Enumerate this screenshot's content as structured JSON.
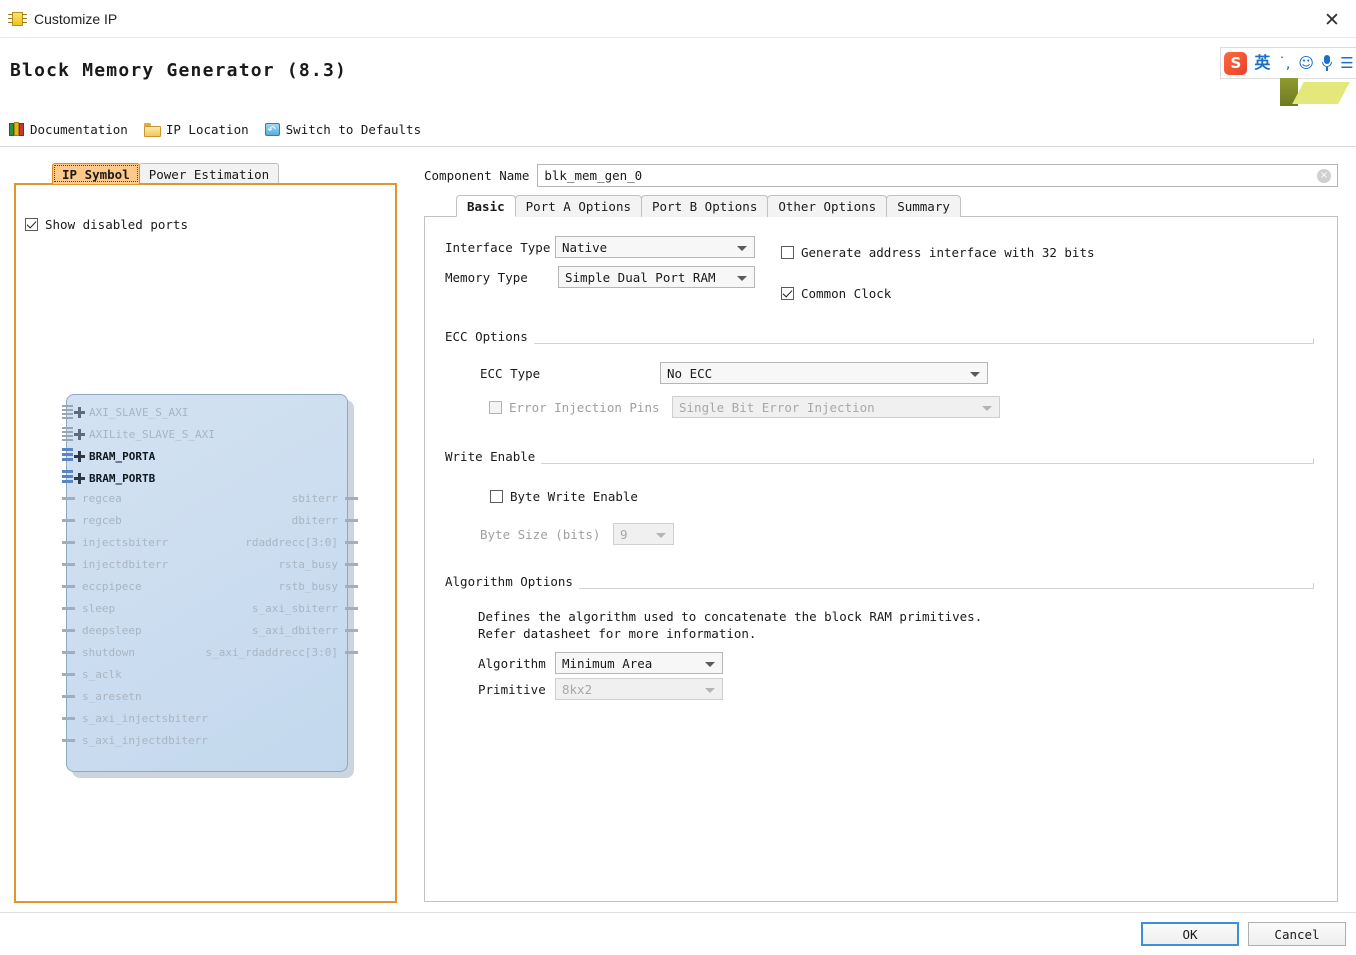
{
  "window": {
    "title": "Customize IP",
    "icon": "ip-chip-icon",
    "close_label": "✕"
  },
  "header": {
    "title": "Block Memory Generator  (8.3)"
  },
  "ime": {
    "logo": "S",
    "mode": "英",
    "punctuation": "˙,",
    "emoji": "☺",
    "mic": "microphone-icon",
    "extra": "☰"
  },
  "toolbar": {
    "items": [
      {
        "label": "Documentation",
        "icon": "books-icon"
      },
      {
        "label": "IP Location",
        "icon": "folder-icon"
      },
      {
        "label": "Switch to Defaults",
        "icon": "switch-icon"
      }
    ]
  },
  "left_panel": {
    "tabs": [
      {
        "label": "IP Symbol",
        "active": true
      },
      {
        "label": "Power Estimation",
        "active": false
      }
    ],
    "show_disabled_ports": {
      "label": "Show disabled ports",
      "checked": true
    },
    "bus_ports": [
      {
        "name": "AXI_SLAVE_S_AXI",
        "enabled": false
      },
      {
        "name": "AXILite_SLAVE_S_AXI",
        "enabled": false
      },
      {
        "name": "BRAM_PORTA",
        "enabled": true
      },
      {
        "name": "BRAM_PORTB",
        "enabled": true
      }
    ],
    "input_ports": [
      "regcea",
      "regceb",
      "injectsbiterr",
      "injectdbiterr",
      "eccpipece",
      "sleep",
      "deepsleep",
      "shutdown",
      "s_aclk",
      "s_aresetn",
      "s_axi_injectsbiterr",
      "s_axi_injectdbiterr"
    ],
    "output_ports": [
      "sbiterr",
      "dbiterr",
      "rdaddrecc[3:0]",
      "rsta_busy",
      "rstb_busy",
      "s_axi_sbiterr",
      "s_axi_dbiterr",
      "s_axi_rdaddrecc[3:0]"
    ]
  },
  "component": {
    "label": "Component Name",
    "value": "blk_mem_gen_0",
    "clear_icon": "×"
  },
  "tabs": [
    {
      "label": "Basic",
      "active": true
    },
    {
      "label": "Port A Options",
      "active": false
    },
    {
      "label": "Port B Options",
      "active": false
    },
    {
      "label": "Other Options",
      "active": false
    },
    {
      "label": "Summary",
      "active": false
    }
  ],
  "basic": {
    "interface_type": {
      "label": "Interface Type",
      "value": "Native"
    },
    "memory_type": {
      "label": "Memory Type",
      "value": "Simple Dual Port RAM"
    },
    "generate_address_interface": {
      "label": "Generate address interface with 32 bits",
      "checked": false
    },
    "common_clock": {
      "label": "Common Clock",
      "checked": true
    },
    "ecc_options": {
      "title": "ECC Options",
      "ecc_type": {
        "label": "ECC Type",
        "value": "No ECC"
      },
      "error_injection_pins": {
        "label": "Error Injection Pins",
        "checked": false,
        "value": "Single Bit Error Injection"
      }
    },
    "write_enable": {
      "title": "Write Enable",
      "byte_write_enable": {
        "label": "Byte Write Enable",
        "checked": false
      },
      "byte_size": {
        "label": "Byte Size (bits)",
        "value": "9"
      }
    },
    "algorithm_options": {
      "title": "Algorithm Options",
      "description": "Defines the algorithm used to concatenate the block RAM primitives.\nRefer datasheet for more information.",
      "algorithm": {
        "label": "Algorithm",
        "value": "Minimum Area"
      },
      "primitive": {
        "label": "Primitive",
        "value": "8kx2"
      }
    }
  },
  "footer": {
    "ok_label": "OK",
    "cancel_label": "Cancel"
  },
  "colors": {
    "accent_orange": "#e2952e",
    "focus_blue": "#3f8fd8",
    "block_fill": "#cddef0"
  }
}
